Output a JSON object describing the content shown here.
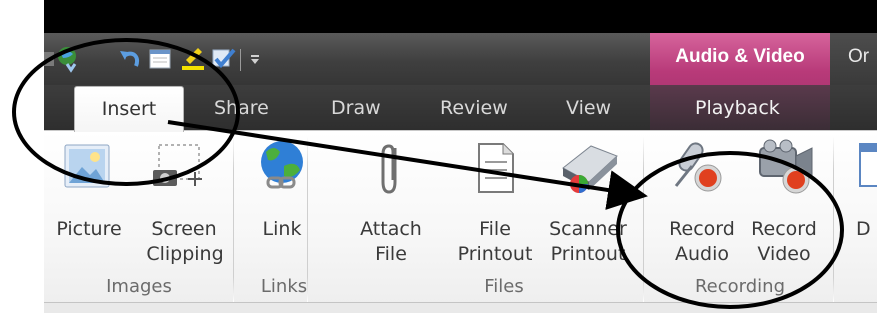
{
  "window": {
    "title_bar_color": "#000000"
  },
  "contextual_tab_group": {
    "label": "Audio & Video",
    "color": "#b83a79"
  },
  "next_context_label": "Or",
  "tabs": [
    {
      "label": "Insert",
      "active": true
    },
    {
      "label": "Share"
    },
    {
      "label": "Draw"
    },
    {
      "label": "Review"
    },
    {
      "label": "View"
    },
    {
      "label": "Playback",
      "contextual": true
    }
  ],
  "ribbon": {
    "groups": [
      {
        "label": "Images",
        "commands": [
          {
            "label_line1": "Picture",
            "label_line2": "",
            "icon": "picture-icon"
          },
          {
            "label_line1": "Screen",
            "label_line2": "Clipping",
            "icon": "screen-clipping-icon"
          }
        ]
      },
      {
        "label": "Links",
        "commands": [
          {
            "label_line1": "Link",
            "label_line2": "",
            "icon": "globe-link-icon"
          }
        ]
      },
      {
        "label": "Files",
        "commands": [
          {
            "label_line1": "Attach",
            "label_line2": "File",
            "icon": "paperclip-icon"
          },
          {
            "label_line1": "File",
            "label_line2": "Printout",
            "icon": "file-printout-icon"
          },
          {
            "label_line1": "Scanner",
            "label_line2": "Printout",
            "icon": "scanner-icon"
          }
        ]
      },
      {
        "label": "Recording",
        "commands": [
          {
            "label_line1": "Record",
            "label_line2": "Audio",
            "icon": "record-audio-icon"
          },
          {
            "label_line1": "Record",
            "label_line2": "Video",
            "icon": "record-video-icon"
          }
        ]
      }
    ],
    "cutoff_command": {
      "label_line1": "D",
      "icon": "partial-icon"
    }
  },
  "quick_access": [
    {
      "icon": "onenote-sync-icon"
    },
    {
      "icon": "undo-icon"
    },
    {
      "icon": "dock-icon"
    },
    {
      "icon": "highlighter-icon"
    },
    {
      "icon": "checkmark-tag-icon"
    },
    {
      "icon": "customize-dropdown-icon"
    }
  ],
  "annotations": {
    "color": "#000000"
  }
}
